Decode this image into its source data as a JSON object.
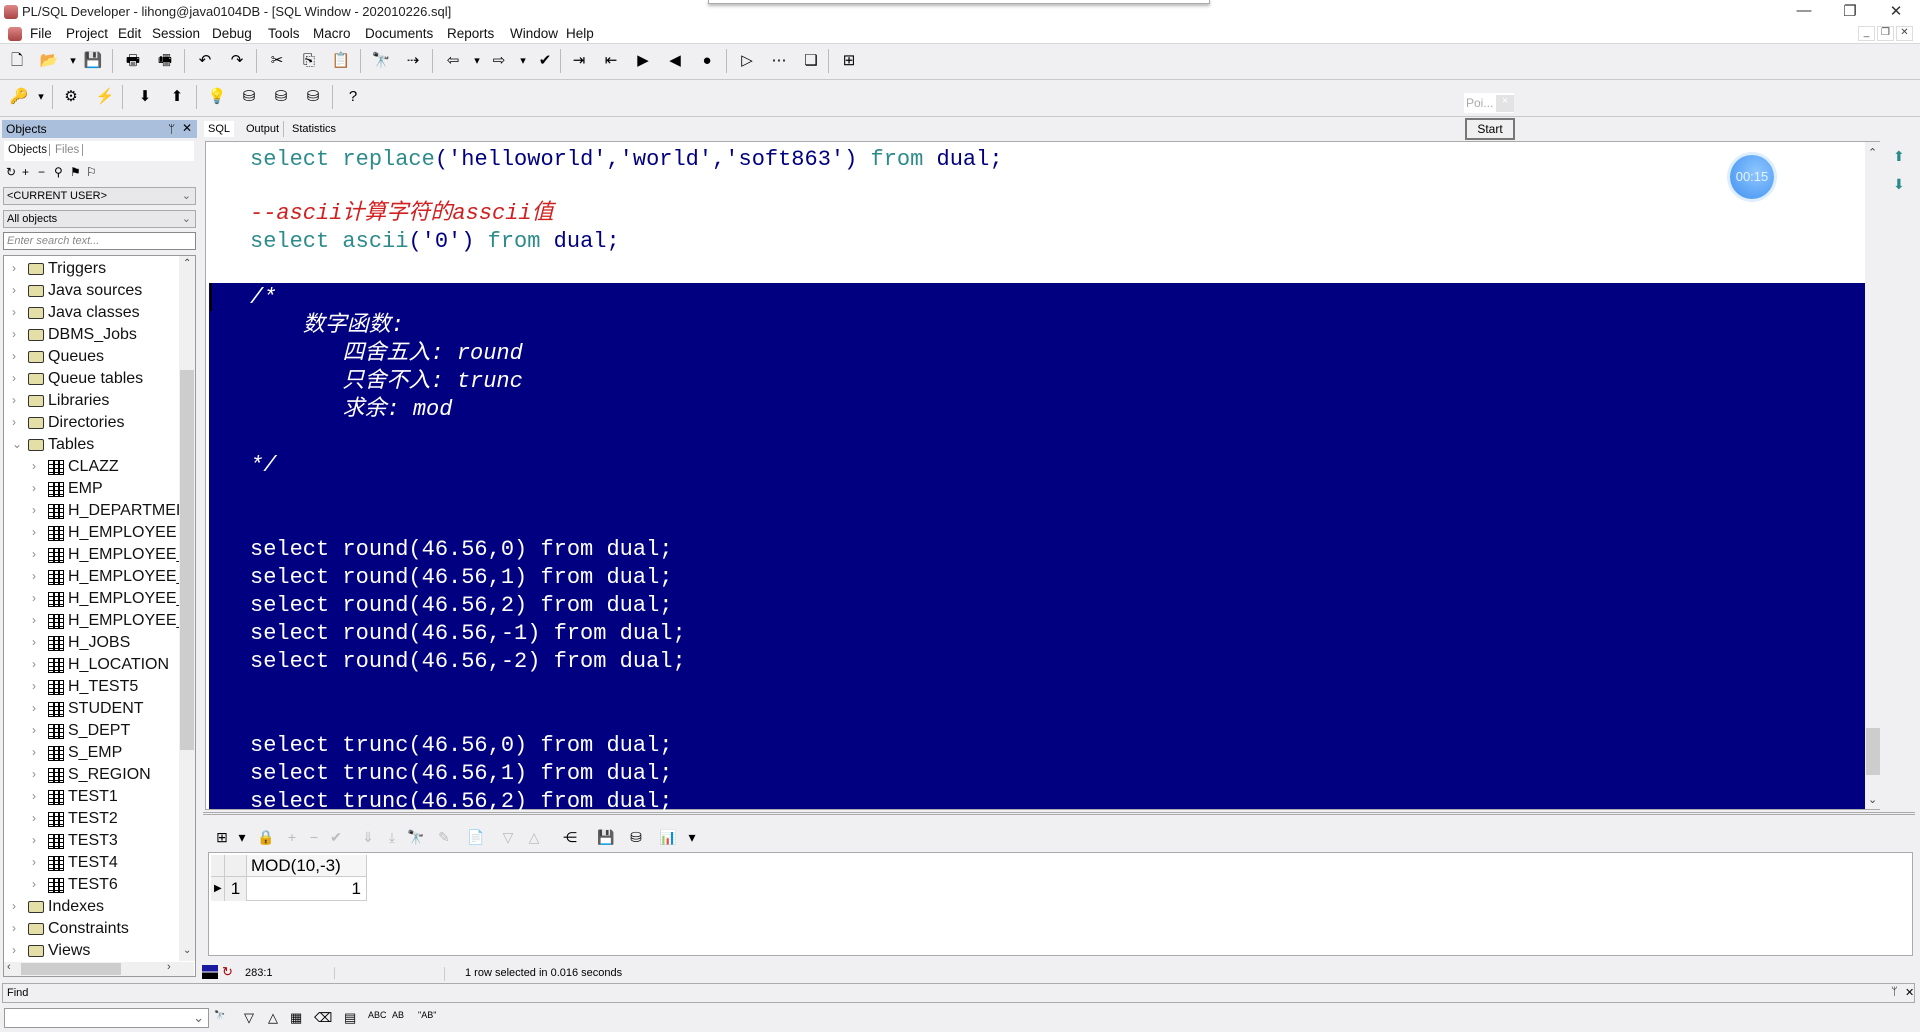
{
  "window": {
    "title": "PL/SQL Developer - lihong@java0104DB - [SQL Window - 202010226.sql]",
    "controls": {
      "minimize": "—",
      "maximize": "❐",
      "close": "✕"
    },
    "mdi_controls": {
      "minimize": "_",
      "restore": "❐",
      "close": "✕"
    }
  },
  "menu": [
    "File",
    "Project",
    "Edit",
    "Session",
    "Debug",
    "Tools",
    "Macro",
    "Documents",
    "Reports",
    "Window",
    "Help"
  ],
  "toolbar1": [
    {
      "icon": "new-icon",
      "glyph": "🗋"
    },
    {
      "icon": "open-icon",
      "glyph": "📂"
    },
    {
      "icon": "dropdown-icon",
      "glyph": "▾"
    },
    {
      "icon": "save-icon",
      "glyph": "💾"
    },
    {
      "icon": "print-icon",
      "glyph": "🖶"
    },
    {
      "icon": "print-setup-icon",
      "glyph": "🖷"
    },
    {
      "icon": "undo-icon",
      "glyph": "↶"
    },
    {
      "icon": "redo-icon",
      "glyph": "↷"
    },
    {
      "icon": "cut-icon",
      "glyph": "✂"
    },
    {
      "icon": "copy-icon",
      "glyph": "⎘"
    },
    {
      "icon": "paste-icon",
      "glyph": "📋"
    },
    {
      "icon": "find-icon",
      "glyph": "🔭"
    },
    {
      "icon": "find-next-icon",
      "glyph": "⇢"
    },
    {
      "icon": "load-icon",
      "glyph": "⇦"
    },
    {
      "icon": "dropdown-icon",
      "glyph": "▾"
    },
    {
      "icon": "export-icon",
      "glyph": "⇨"
    },
    {
      "icon": "dropdown-icon",
      "glyph": "▾"
    },
    {
      "icon": "check-syntax-icon",
      "glyph": "✔"
    },
    {
      "icon": "indent-icon",
      "glyph": "⇥"
    },
    {
      "icon": "unindent-icon",
      "glyph": "⇤"
    },
    {
      "icon": "comment-icon",
      "glyph": "▶"
    },
    {
      "icon": "uncomment-icon",
      "glyph": "◀"
    },
    {
      "icon": "record-macro-icon",
      "glyph": "●"
    },
    {
      "icon": "play-macro-icon",
      "glyph": "▷"
    },
    {
      "icon": "macro-library-icon",
      "glyph": "⋯"
    },
    {
      "icon": "windows-list-icon",
      "glyph": "❏"
    },
    {
      "icon": "tile-windows-icon",
      "glyph": "⊞"
    }
  ],
  "toolbar2": [
    {
      "icon": "logon-icon",
      "glyph": "🔑"
    },
    {
      "icon": "dropdown-icon",
      "glyph": "▾"
    },
    {
      "icon": "execute-icon",
      "glyph": "⚙"
    },
    {
      "icon": "break-icon",
      "glyph": "⚡"
    },
    {
      "icon": "commit-icon",
      "glyph": "⬇"
    },
    {
      "icon": "rollback-icon",
      "glyph": "⬆"
    },
    {
      "icon": "explain-plan-icon",
      "glyph": "💡"
    },
    {
      "icon": "sql-trace-icon",
      "glyph": "⛁"
    },
    {
      "icon": "session-find-icon",
      "glyph": "⛁"
    },
    {
      "icon": "disconnect-icon",
      "glyph": "⛁"
    },
    {
      "icon": "help-icon",
      "glyph": "?"
    }
  ],
  "floating": {
    "title": "Poi...",
    "close": "×",
    "start_label": "Start",
    "timer": "00:15"
  },
  "objects_panel": {
    "title": "Objects",
    "pin": "ᛘ",
    "close": "✕",
    "tabs": [
      "Objects",
      "Files"
    ],
    "tool_icons": [
      {
        "icon": "refresh-icon",
        "glyph": "↻"
      },
      {
        "icon": "add-icon",
        "glyph": "+"
      },
      {
        "icon": "remove-icon",
        "glyph": "−"
      },
      {
        "icon": "find-icon",
        "glyph": "⚲"
      },
      {
        "icon": "filter-icon",
        "glyph": "⚑"
      },
      {
        "icon": "filter-edit-icon",
        "glyph": "⚐"
      }
    ],
    "user_select": "<CURRENT USER>",
    "type_select": "All objects",
    "search_placeholder": "Enter search text...",
    "tree": [
      {
        "label": "Triggers",
        "type": "folder",
        "level": 0
      },
      {
        "label": "Java sources",
        "type": "folder",
        "level": 0
      },
      {
        "label": "Java classes",
        "type": "folder",
        "level": 0
      },
      {
        "label": "DBMS_Jobs",
        "type": "folder",
        "level": 0
      },
      {
        "label": "Queues",
        "type": "folder",
        "level": 0
      },
      {
        "label": "Queue tables",
        "type": "folder",
        "level": 0
      },
      {
        "label": "Libraries",
        "type": "folder",
        "level": 0
      },
      {
        "label": "Directories",
        "type": "folder",
        "level": 0
      },
      {
        "label": "Tables",
        "type": "folder-open",
        "level": 0
      },
      {
        "label": "CLAZZ",
        "type": "table",
        "level": 1
      },
      {
        "label": "EMP",
        "type": "table",
        "level": 1
      },
      {
        "label": "H_DEPARTMEI",
        "type": "table",
        "level": 1
      },
      {
        "label": "H_EMPLOYEE",
        "type": "table",
        "level": 1
      },
      {
        "label": "H_EMPLOYEE_",
        "type": "table",
        "level": 1
      },
      {
        "label": "H_EMPLOYEE_",
        "type": "table",
        "level": 1
      },
      {
        "label": "H_EMPLOYEE_",
        "type": "table",
        "level": 1
      },
      {
        "label": "H_EMPLOYEE_",
        "type": "table",
        "level": 1
      },
      {
        "label": "H_JOBS",
        "type": "table",
        "level": 1
      },
      {
        "label": "H_LOCATION",
        "type": "table",
        "level": 1
      },
      {
        "label": "H_TEST5",
        "type": "table",
        "level": 1
      },
      {
        "label": "STUDENT",
        "type": "table",
        "level": 1
      },
      {
        "label": "S_DEPT",
        "type": "table",
        "level": 1
      },
      {
        "label": "S_EMP",
        "type": "table",
        "level": 1
      },
      {
        "label": "S_REGION",
        "type": "table",
        "level": 1
      },
      {
        "label": "TEST1",
        "type": "table",
        "level": 1
      },
      {
        "label": "TEST2",
        "type": "table",
        "level": 1
      },
      {
        "label": "TEST3",
        "type": "table",
        "level": 1
      },
      {
        "label": "TEST4",
        "type": "table",
        "level": 1
      },
      {
        "label": "TEST6",
        "type": "table",
        "level": 1
      },
      {
        "label": "Indexes",
        "type": "folder",
        "level": 0
      },
      {
        "label": "Constraints",
        "type": "folder",
        "level": 0
      },
      {
        "label": "Views",
        "type": "folder",
        "level": 0
      }
    ]
  },
  "editor": {
    "tabs": [
      "SQL",
      "Output",
      "Statistics"
    ],
    "active_tab": "SQL",
    "lines": [
      {
        "tokens": [
          [
            "kw",
            "select "
          ],
          [
            "kw",
            "replace"
          ],
          [
            "id",
            "('helloworld','world','soft863') "
          ],
          [
            "kw",
            "from "
          ],
          [
            "id",
            "dual;"
          ]
        ],
        "selected": false
      },
      {
        "tokens": [],
        "selected": false
      },
      {
        "tokens": [
          [
            "cm",
            "--ascii计算字符的asscii值"
          ]
        ],
        "selected": false
      },
      {
        "tokens": [
          [
            "kw",
            "select "
          ],
          [
            "kw",
            "ascii"
          ],
          [
            "id",
            "('0') "
          ],
          [
            "kw",
            "from "
          ],
          [
            "id",
            "dual;"
          ]
        ],
        "selected": false
      },
      {
        "tokens": [],
        "selected": false
      },
      {
        "tokens": [
          [
            "selc",
            "/*"
          ]
        ],
        "selected": true
      },
      {
        "tokens": [
          [
            "selc",
            "    数字函数:"
          ]
        ],
        "selected": true
      },
      {
        "tokens": [
          [
            "selc",
            "       四舍五入: round"
          ]
        ],
        "selected": true
      },
      {
        "tokens": [
          [
            "selc",
            "       只舍不入: trunc"
          ]
        ],
        "selected": true
      },
      {
        "tokens": [
          [
            "selc",
            "       求余: mod"
          ]
        ],
        "selected": true
      },
      {
        "tokens": [],
        "selected": true
      },
      {
        "tokens": [
          [
            "selc",
            "*/"
          ]
        ],
        "selected": true
      },
      {
        "tokens": [],
        "selected": true
      },
      {
        "tokens": [],
        "selected": true
      },
      {
        "tokens": [
          [
            "sel",
            "select round(46.56,0) from dual;"
          ]
        ],
        "selected": true
      },
      {
        "tokens": [
          [
            "sel",
            "select round(46.56,1) from dual;"
          ]
        ],
        "selected": true
      },
      {
        "tokens": [
          [
            "sel",
            "select round(46.56,2) from dual;"
          ]
        ],
        "selected": true
      },
      {
        "tokens": [
          [
            "sel",
            "select round(46.56,-1) from dual;"
          ]
        ],
        "selected": true
      },
      {
        "tokens": [
          [
            "sel",
            "select round(46.56,-2) from dual;"
          ]
        ],
        "selected": true
      },
      {
        "tokens": [],
        "selected": true
      },
      {
        "tokens": [],
        "selected": true
      },
      {
        "tokens": [
          [
            "sel",
            "select trunc(46.56,0) from dual;"
          ]
        ],
        "selected": true
      },
      {
        "tokens": [
          [
            "sel",
            "select trunc(46.56,1) from dual;"
          ]
        ],
        "selected": true
      },
      {
        "tokens": [
          [
            "sel",
            "select trunc(46.56,2) from dual;"
          ]
        ],
        "selected": true
      }
    ],
    "colors": {
      "keyword": "#2e8b8b",
      "identifier": "#000080",
      "comment": "#d02020",
      "selection_bg": "#000080",
      "selection_fg": "#ffffff"
    }
  },
  "result_toolbar": [
    {
      "icon": "grid-options-icon",
      "glyph": "⊞"
    },
    {
      "icon": "dropdown-icon",
      "glyph": "▾"
    },
    {
      "icon": "lock-icon",
      "glyph": "🔒"
    },
    {
      "icon": "insert-record-icon",
      "glyph": "+"
    },
    {
      "icon": "delete-record-icon",
      "glyph": "−"
    },
    {
      "icon": "post-changes-icon",
      "glyph": "✔"
    },
    {
      "icon": "next-page-icon",
      "glyph": "⇓"
    },
    {
      "icon": "last-page-icon",
      "glyph": "⤓"
    },
    {
      "icon": "find-icon",
      "glyph": "🔭"
    },
    {
      "icon": "clear-icon",
      "glyph": "✎"
    },
    {
      "icon": "export-results-icon",
      "glyph": "📄"
    },
    {
      "icon": "previous-icon",
      "glyph": "▽"
    },
    {
      "icon": "next-icon",
      "glyph": "△"
    },
    {
      "icon": "query-plan-icon",
      "glyph": "⋲"
    },
    {
      "icon": "save-icon",
      "glyph": "💾"
    },
    {
      "icon": "fetch-icon",
      "glyph": "⛁"
    },
    {
      "icon": "chart-icon",
      "glyph": "📊"
    },
    {
      "icon": "dropdown-icon",
      "glyph": "▾"
    }
  ],
  "result_grid": {
    "columns": [
      "MOD(10,-3)"
    ],
    "rows": [
      {
        "num": "1",
        "values": [
          "1"
        ]
      }
    ]
  },
  "status": {
    "position": "283:1",
    "message": "1 row selected in 0.016 seconds"
  },
  "find": {
    "label": "Find",
    "value": "",
    "icons": [
      {
        "icon": "find-icon",
        "glyph": "🔭"
      },
      {
        "icon": "find-next-icon",
        "glyph": "▽"
      },
      {
        "icon": "find-previous-icon",
        "glyph": "△"
      },
      {
        "icon": "highlight-icon",
        "glyph": "▦"
      },
      {
        "icon": "clear-icon",
        "glyph": "⌫"
      },
      {
        "icon": "selection-only-icon",
        "glyph": "▤"
      },
      {
        "icon": "match-case-icon",
        "glyph": "ABC"
      },
      {
        "icon": "whole-word-icon",
        "glyph": "AB"
      },
      {
        "icon": "regex-icon",
        "glyph": "\"AB\""
      }
    ]
  }
}
